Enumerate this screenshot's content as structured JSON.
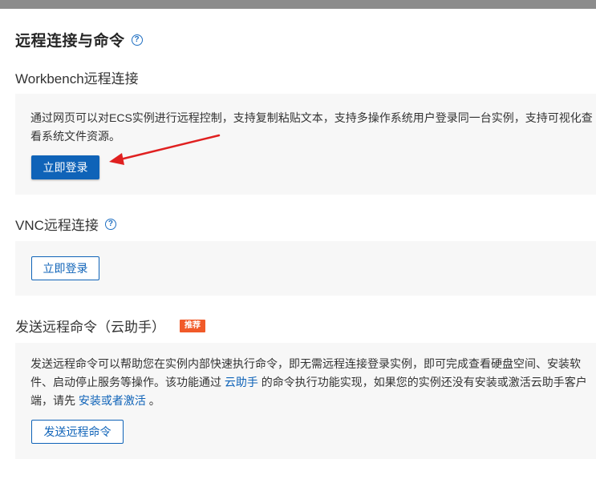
{
  "page": {
    "title": "远程连接与命令",
    "help_icon": "help-circle-icon"
  },
  "workbench": {
    "title": "Workbench远程连接",
    "description": "通过网页可以对ECS实例进行远程控制，支持复制粘贴文本，支持多操作系统用户登录同一台实例，支持可视化查看系统文件资源。",
    "login_button": "立即登录"
  },
  "vnc": {
    "title": "VNC远程连接",
    "help_icon": "help-circle-icon",
    "login_button": "立即登录"
  },
  "cloud_assistant": {
    "title": "发送远程命令（云助手）",
    "badge": "推荐",
    "text_part1": "发送远程命令可以帮助您在实例内部快速执行命令，即无需远程连接登录实例，即可完成查看硬盘空间、安装软件、启动停止服务等操作。该功能通过 ",
    "link_cloud_assistant": "云助手",
    "text_part2": " 的命令执行功能实现，如果您的实例还没有安装或激活云助手客户端，请先 ",
    "link_install": "安装或者激活",
    "text_part3": " 。",
    "send_button": "发送远程命令"
  },
  "colors": {
    "primary": "#0f63b8",
    "badge": "#f15a29",
    "annotation_arrow": "#e02020",
    "panel_bg": "#f7f7f7"
  }
}
